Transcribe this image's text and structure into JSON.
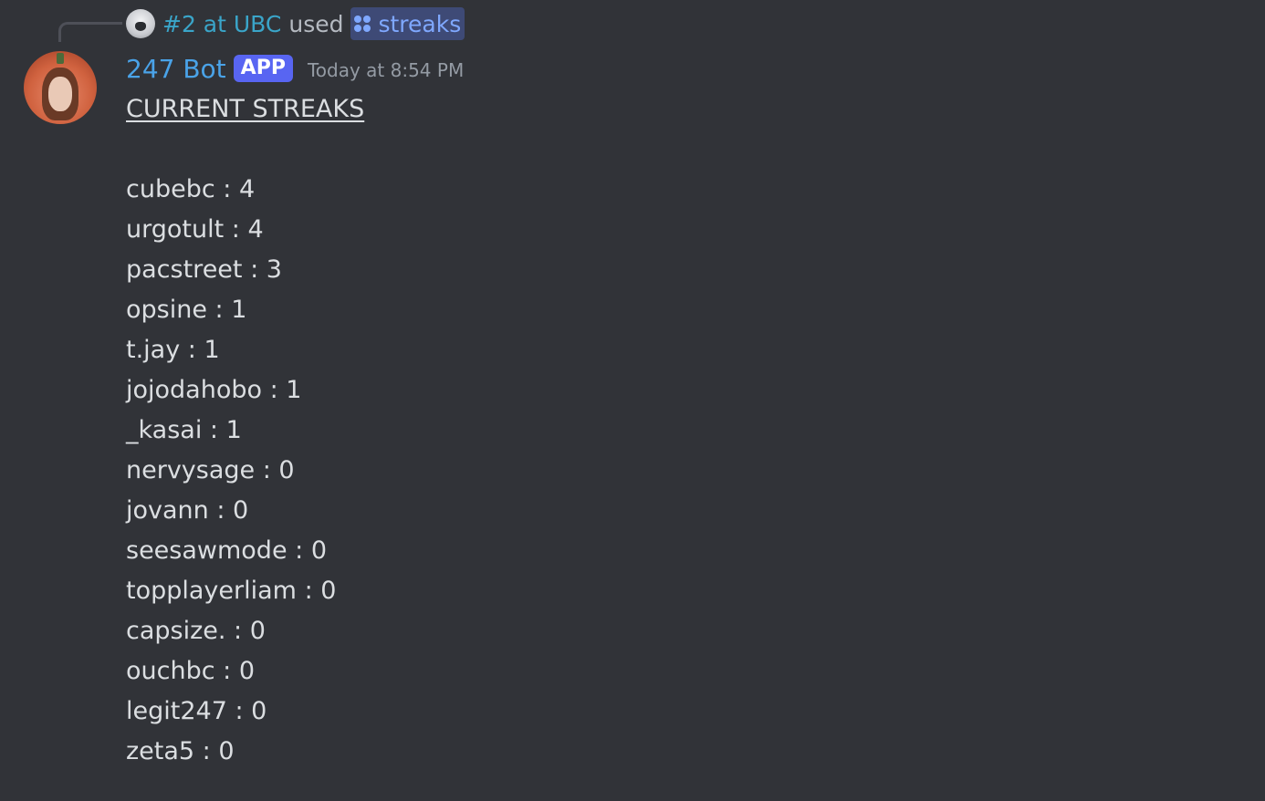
{
  "command_usage": {
    "user": "#2 at UBC",
    "used_text": "used",
    "command": "streaks"
  },
  "message": {
    "author": "247 Bot",
    "badge": "APP",
    "timestamp": "Today at 8:54 PM",
    "title": "CURRENT STREAKS",
    "streaks": [
      {
        "name": "cubebc",
        "sep": " : ",
        "value": "4"
      },
      {
        "name": "urgotult",
        "sep": " : ",
        "value": "4"
      },
      {
        "name": "pacstreet",
        "sep": " : ",
        "value": "3"
      },
      {
        "name": "opsine",
        "sep": " : ",
        "value": "1"
      },
      {
        "name": "t.jay",
        "sep": " : ",
        "value": "1"
      },
      {
        "name": "jojodahobo",
        "sep": " : ",
        "value": "1"
      },
      {
        "name": "_kasai",
        "sep": " : ",
        "value": "1"
      },
      {
        "name": "nervysage",
        "sep": " : ",
        "value": "0"
      },
      {
        "name": "jovann",
        "sep": " : ",
        "value": "0"
      },
      {
        "name": "seesawmode",
        "sep": " : ",
        "value": "0"
      },
      {
        "name": "topplayerliam",
        "sep": " : ",
        "value": "0"
      },
      {
        "name": "capsize.",
        "sep": " : ",
        "value": "0"
      },
      {
        "name": "ouchbc",
        "sep": " : ",
        "value": "0"
      },
      {
        "name": "legit247",
        "sep": " : ",
        "value": "0"
      },
      {
        "name": "zeta5",
        "sep": " : ",
        "value": "0"
      }
    ]
  },
  "colors": {
    "background": "#313338",
    "reply_user": "#3aa5c9",
    "command": "#7fa8ff",
    "author": "#4aa3e8",
    "app_badge": "#5865f2",
    "timestamp": "#949ba4",
    "text": "#dbdee1"
  },
  "icons": {
    "command_icon": "slash-command-dots-icon",
    "reply_spine": "reply-spine-icon"
  }
}
